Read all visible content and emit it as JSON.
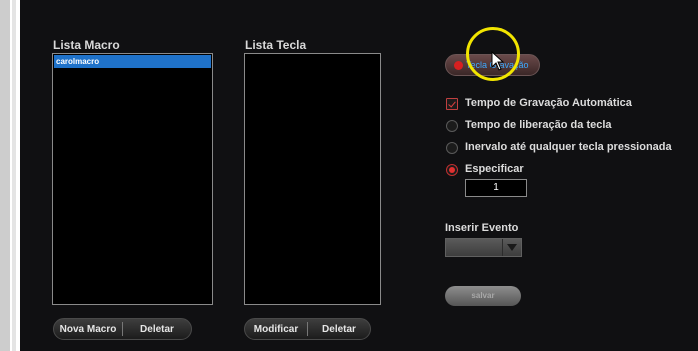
{
  "macro_list": {
    "label": "Lista Macro",
    "items": [
      "carolmacro"
    ],
    "new_button": "Nova Macro",
    "delete_button": "Deletar"
  },
  "key_list": {
    "label": "Lista Tecla",
    "modify_button": "Modificar",
    "delete_button": "Deletar"
  },
  "record_button": "Tecla Gravação",
  "options": [
    {
      "label": "Tempo de Gravação Automática",
      "type": "checkbox",
      "checked": true
    },
    {
      "label": "Tempo de liberação da tecla",
      "type": "radio",
      "checked": false
    },
    {
      "label": "Inervalo até qualquer tecla pressionada",
      "type": "radio",
      "checked": false
    },
    {
      "label": "Especificar",
      "type": "radio",
      "checked": true
    }
  ],
  "specify_value": "1",
  "insert_event": {
    "label": "Inserir Evento",
    "selected": ""
  },
  "save_button": "salvar",
  "colors": {
    "selection": "#1f72c9",
    "accent_red": "#e03030",
    "highlight_ring": "#f2e500"
  }
}
